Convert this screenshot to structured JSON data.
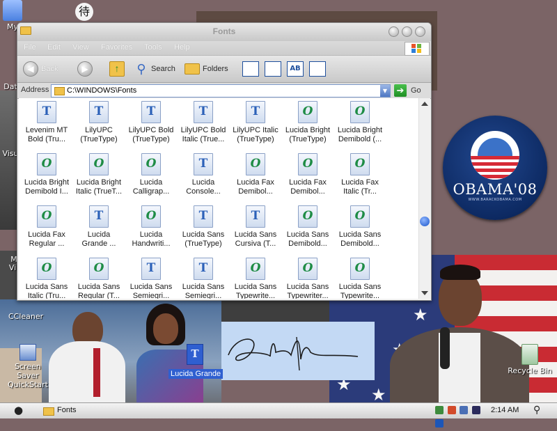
{
  "window": {
    "title": "Fonts",
    "menu": [
      "File",
      "Edit",
      "View",
      "Favorites",
      "Tools",
      "Help"
    ],
    "toolbar": {
      "back_label": "Back",
      "search_label": "Search",
      "folders_label": "Folders"
    },
    "address": {
      "label": "Address",
      "path": "C:\\WINDOWS\\Fonts",
      "go_label": "Go"
    },
    "items": [
      {
        "l1": "Levenim MT",
        "l2": "Bold (Tru...",
        "type": "tt"
      },
      {
        "l1": "LilyUPC",
        "l2": "(TrueType)",
        "type": "tt"
      },
      {
        "l1": "LilyUPC Bold",
        "l2": "(TrueType)",
        "type": "tt"
      },
      {
        "l1": "LilyUPC Bold",
        "l2": "Italic (True...",
        "type": "tt"
      },
      {
        "l1": "LilyUPC Italic",
        "l2": "(TrueType)",
        "type": "tt"
      },
      {
        "l1": "Lucida Bright",
        "l2": "(TrueType)",
        "type": "ot"
      },
      {
        "l1": "Lucida Bright",
        "l2": "Demibold (...",
        "type": "ot"
      },
      {
        "l1": "Lucida Bright",
        "l2": "Demibold I...",
        "type": "ot"
      },
      {
        "l1": "Lucida Bright",
        "l2": "Italic (TrueT...",
        "type": "ot"
      },
      {
        "l1": "Lucida",
        "l2": "Calligrap...",
        "type": "ot"
      },
      {
        "l1": "Lucida",
        "l2": "Console...",
        "type": "tt"
      },
      {
        "l1": "Lucida Fax",
        "l2": "Demibol...",
        "type": "ot"
      },
      {
        "l1": "Lucida Fax",
        "l2": "Demibol...",
        "type": "ot"
      },
      {
        "l1": "Lucida Fax",
        "l2": "Italic (Tr...",
        "type": "ot"
      },
      {
        "l1": "Lucida Fax",
        "l2": "Regular ...",
        "type": "ot"
      },
      {
        "l1": "Lucida",
        "l2": "Grande ...",
        "type": "tt"
      },
      {
        "l1": "Lucida",
        "l2": "Handwriti...",
        "type": "ot"
      },
      {
        "l1": "Lucida Sans",
        "l2": "(TrueType)",
        "type": "tt"
      },
      {
        "l1": "Lucida Sans",
        "l2": "Cursiva (T...",
        "type": "tt"
      },
      {
        "l1": "Lucida Sans",
        "l2": "Demibold...",
        "type": "ot"
      },
      {
        "l1": "Lucida Sans",
        "l2": "Demibold...",
        "type": "ot"
      },
      {
        "l1": "Lucida Sans",
        "l2": "Italic (Tru...",
        "type": "ot"
      },
      {
        "l1": "Lucida Sans",
        "l2": "Regular (T...",
        "type": "ot"
      },
      {
        "l1": "Lucida Sans",
        "l2": "Semiegri...",
        "type": "tt"
      },
      {
        "l1": "Lucida Sans",
        "l2": "Semiegri...",
        "type": "tt"
      },
      {
        "l1": "Lucida Sans",
        "l2": "Typewrite...",
        "type": "ot"
      },
      {
        "l1": "Lucida Sans",
        "l2": "Typewriter...",
        "type": "ot"
      },
      {
        "l1": "Lucida Sans",
        "l2": "Typewrite...",
        "type": "ot"
      }
    ]
  },
  "desktop": {
    "icons": {
      "my": "My",
      "dat": "Dat",
      "visu": "Visu",
      "m": "M",
      "vi": "Vi",
      "ccleaner": "CCleaner",
      "screensaver": "Screen Saver QuickStart",
      "recycle": "Recycle Bin",
      "selected": "Lucida Grande"
    },
    "obama_button": {
      "text": "OBAMA'08",
      "url": "WWW.BARACKOBAMA.COM"
    }
  },
  "taskbar": {
    "item_label": "Fonts",
    "clock": "2:14 AM"
  },
  "colors": {
    "desktop": "#7b6466",
    "selection": "#2f5fd0",
    "truetype_glyph": "#2c61b8",
    "opentype_glyph": "#1e8c45"
  },
  "icon_names": [
    "apple-icon",
    "folder-icon",
    "search-icon",
    "back-icon",
    "forward-icon",
    "up-icon",
    "folders-icon",
    "go-arrow-icon",
    "recycle-bin-icon"
  ]
}
